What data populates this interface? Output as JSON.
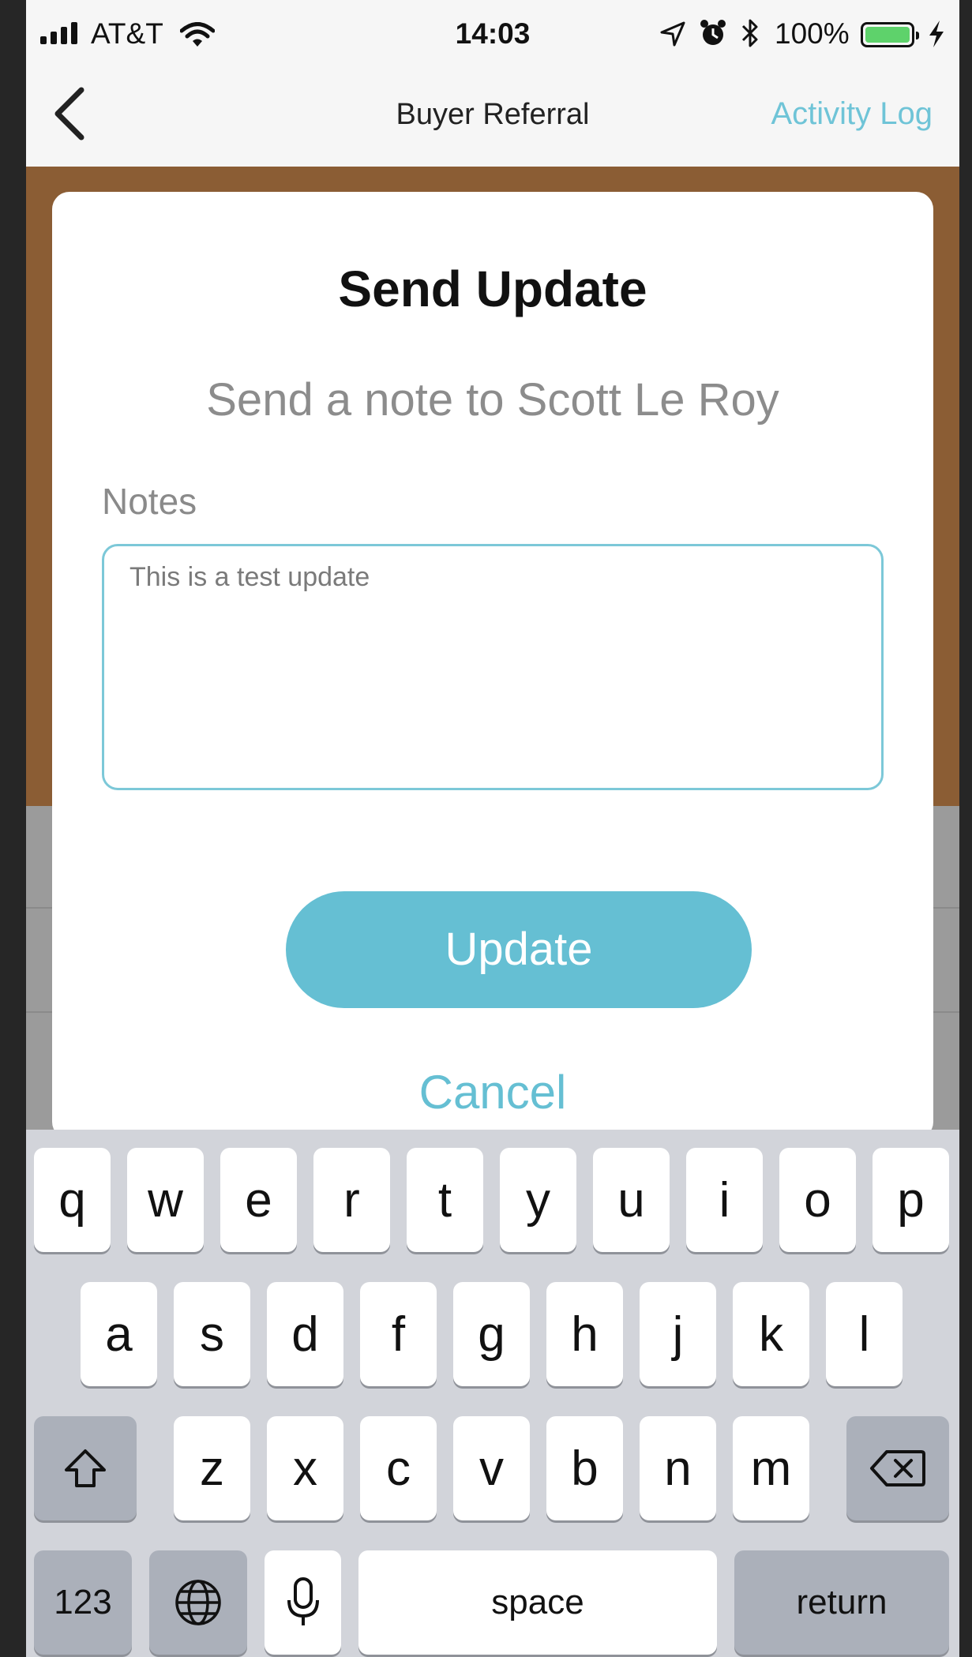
{
  "status_bar": {
    "carrier": "AT&T",
    "time": "14:03",
    "battery_percent": "100%",
    "battery_level": 1.0,
    "icons": [
      "signal-icon",
      "wifi-icon",
      "location-arrow-icon",
      "alarm-icon",
      "bluetooth-icon",
      "battery-icon",
      "charging-icon"
    ]
  },
  "nav": {
    "back_icon": "chevron-left-icon",
    "title": "Buyer Referral",
    "action": "Activity Log"
  },
  "modal": {
    "title": "Send Update",
    "subtitle": "Send a note to Scott Le Roy",
    "notes_label": "Notes",
    "notes_value": "This is a test update",
    "update_label": "Update",
    "cancel_label": "Cancel"
  },
  "keyboard": {
    "row1": [
      "q",
      "w",
      "e",
      "r",
      "t",
      "y",
      "u",
      "i",
      "o",
      "p"
    ],
    "row2": [
      "a",
      "s",
      "d",
      "f",
      "g",
      "h",
      "j",
      "k",
      "l"
    ],
    "row3": [
      "z",
      "x",
      "c",
      "v",
      "b",
      "n",
      "m"
    ],
    "numbers_label": "123",
    "space_label": "space",
    "return_label": "return",
    "icons": [
      "shift-icon",
      "backspace-icon",
      "globe-icon",
      "microphone-icon"
    ]
  },
  "colors": {
    "accent": "#65bfd3",
    "banner": "#8b5d34",
    "battery": "#5ed26b"
  }
}
